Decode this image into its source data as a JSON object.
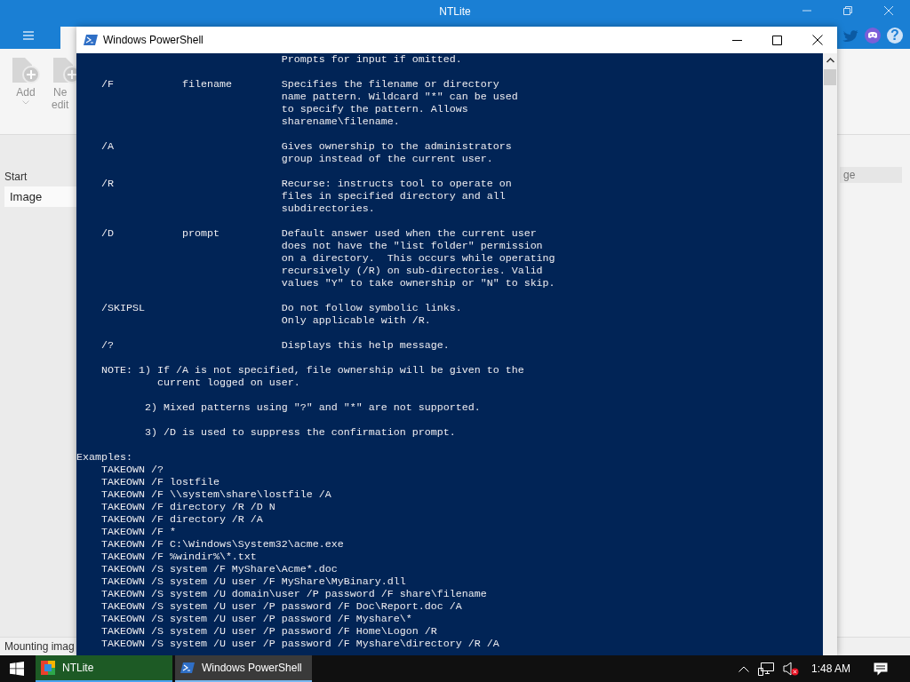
{
  "app": {
    "title": "NTLite",
    "help_label": "?",
    "ribbon_buttons": [
      {
        "label": "Add",
        "has_menu": true,
        "disabled": true
      },
      {
        "label": "Ne\nedit",
        "has_menu": false,
        "disabled": true
      }
    ],
    "left_panel": {
      "header": "Start",
      "items": [
        {
          "label": "Image",
          "selected": true
        }
      ]
    },
    "right_panel": {
      "header": "ge"
    },
    "status": "Mounting imag"
  },
  "console_window": {
    "title": "Windows PowerShell",
    "blocks": [
      {
        "lines": [
          "                                 Prompts for input if omitted."
        ]
      },
      {
        "lines": [
          "    /F           filename        Specifies the filename or directory",
          "                                 name pattern. Wildcard \"*\" can be used",
          "                                 to specify the pattern. Allows",
          "                                 sharename\\filename."
        ]
      },
      {
        "lines": [
          "    /A                           Gives ownership to the administrators",
          "                                 group instead of the current user."
        ]
      },
      {
        "lines": [
          "    /R                           Recurse: instructs tool to operate on",
          "                                 files in specified directory and all",
          "                                 subdirectories."
        ]
      },
      {
        "lines": [
          "    /D           prompt          Default answer used when the current user",
          "                                 does not have the \"list folder\" permission",
          "                                 on a directory.  This occurs while operating",
          "                                 recursively (/R) on sub-directories. Valid",
          "                                 values \"Y\" to take ownership or \"N\" to skip."
        ]
      },
      {
        "lines": [
          "    /SKIPSL                      Do not follow symbolic links.",
          "                                 Only applicable with /R."
        ]
      },
      {
        "lines": [
          "    /?                           Displays this help message."
        ]
      },
      {
        "lines": [
          "    NOTE: 1) If /A is not specified, file ownership will be given to the",
          "             current logged on user."
        ]
      },
      {
        "lines": [
          "           2) Mixed patterns using \"?\" and \"*\" are not supported."
        ]
      },
      {
        "lines": [
          "           3) /D is used to suppress the confirmation prompt."
        ]
      },
      {
        "lines": [
          "Examples:",
          "    TAKEOWN /?",
          "    TAKEOWN /F lostfile",
          "    TAKEOWN /F \\\\system\\share\\lostfile /A",
          "    TAKEOWN /F directory /R /D N",
          "    TAKEOWN /F directory /R /A",
          "    TAKEOWN /F *",
          "    TAKEOWN /F C:\\Windows\\System32\\acme.exe",
          "    TAKEOWN /F %windir%\\*.txt",
          "    TAKEOWN /S system /F MyShare\\Acme*.doc",
          "    TAKEOWN /S system /U user /F MyShare\\MyBinary.dll",
          "    TAKEOWN /S system /U domain\\user /P password /F share\\filename",
          "    TAKEOWN /S system /U user /P password /F Doc\\Report.doc /A",
          "    TAKEOWN /S system /U user /P password /F Myshare\\*",
          "    TAKEOWN /S system /U user /P password /F Home\\Logon /R",
          "    TAKEOWN /S system /U user /P password /F Myshare\\directory /R /A"
        ]
      }
    ]
  },
  "taskbar": {
    "apps": [
      {
        "label": "NTLite",
        "selected": false,
        "level": 1
      },
      {
        "label": "Windows PowerShell",
        "selected": true
      }
    ],
    "clock": "1:48 AM",
    "muted": true
  }
}
